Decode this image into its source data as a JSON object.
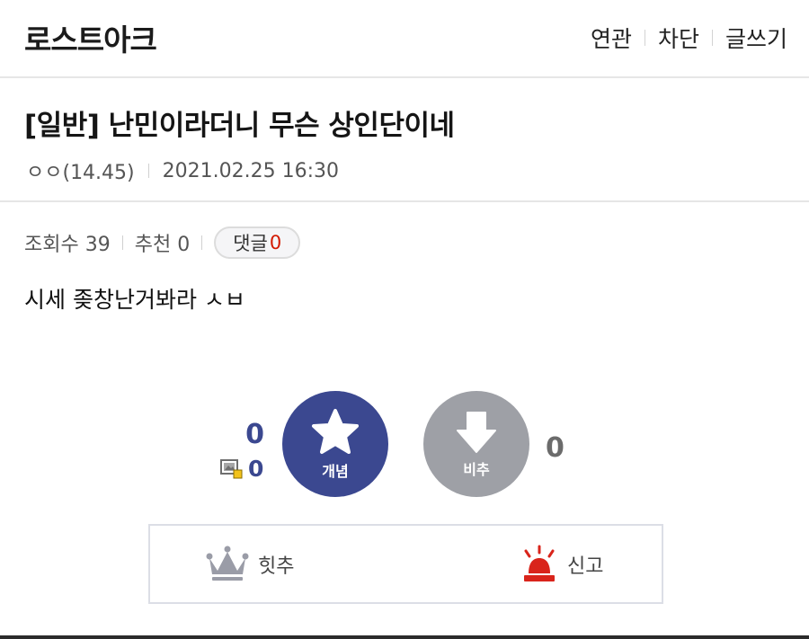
{
  "header": {
    "gallery_title": "로스트아크",
    "nav": [
      "연관",
      "차단",
      "글쓰기"
    ]
  },
  "post": {
    "title": "[일반] 난민이라더니 무슨 상인단이네",
    "author": "ㅇㅇ(14.45)",
    "datetime": "2021.02.25 16:30",
    "views_label": "조회수 39",
    "recommend_label": "추천 0",
    "comment_label": "댓글",
    "comment_count": "0",
    "body": "시세 좆창난거봐라 ㅅㅂ"
  },
  "vote": {
    "up_count": "0",
    "fix_count": "0",
    "up_label": "개념",
    "down_label": "비추",
    "down_count": "0"
  },
  "actions": {
    "hit_label": "힛추",
    "report_label": "신고"
  },
  "colors": {
    "accent": "#3b4890",
    "downvote": "#9ea0a6",
    "comment_count": "#d31900",
    "report": "#d9241b",
    "crown": "#9a9ca7"
  },
  "icons": {
    "upvote": "star-icon",
    "downvote": "arrow-down-icon",
    "fix": "fix-image-icon",
    "hit": "crown-icon",
    "report": "siren-icon"
  }
}
